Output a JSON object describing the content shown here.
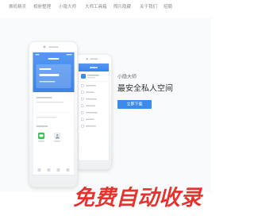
{
  "nav": {
    "items": [
      {
        "label": "换机精灵"
      },
      {
        "label": "相册整理"
      },
      {
        "label": "小隐大师"
      },
      {
        "label": "大师工具箱"
      },
      {
        "label": "照片隐藏"
      },
      {
        "label": "关于我们"
      },
      {
        "label": "招聘"
      }
    ]
  },
  "hero": {
    "app_name": "小隐大师",
    "slogan": "最安全私人空间",
    "download_label": "立即下载"
  },
  "carousel": {
    "slide_count": 3,
    "active_index": 0
  },
  "watermark": {
    "text": "免费自动收录"
  },
  "icons": {
    "back_phone_apps": [
      "wechat-icon",
      "contact-icon"
    ]
  },
  "colors": {
    "accent": "#3b8beb",
    "watermark": "#e5322d"
  }
}
